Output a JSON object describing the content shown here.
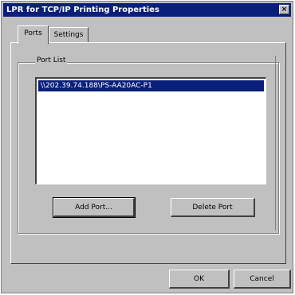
{
  "window": {
    "title": "LPR for TCP/IP Printing Properties",
    "close_label": "×"
  },
  "tabs": [
    {
      "label": "Ports"
    },
    {
      "label": "Settings"
    }
  ],
  "group": {
    "label": "Port List"
  },
  "ports": [
    "\\\\202.39.74.188\\PS-AA20AC-P1"
  ],
  "buttons": {
    "add": "Add Port...",
    "delete": "Delete Port",
    "ok": "OK",
    "cancel": "Cancel"
  }
}
